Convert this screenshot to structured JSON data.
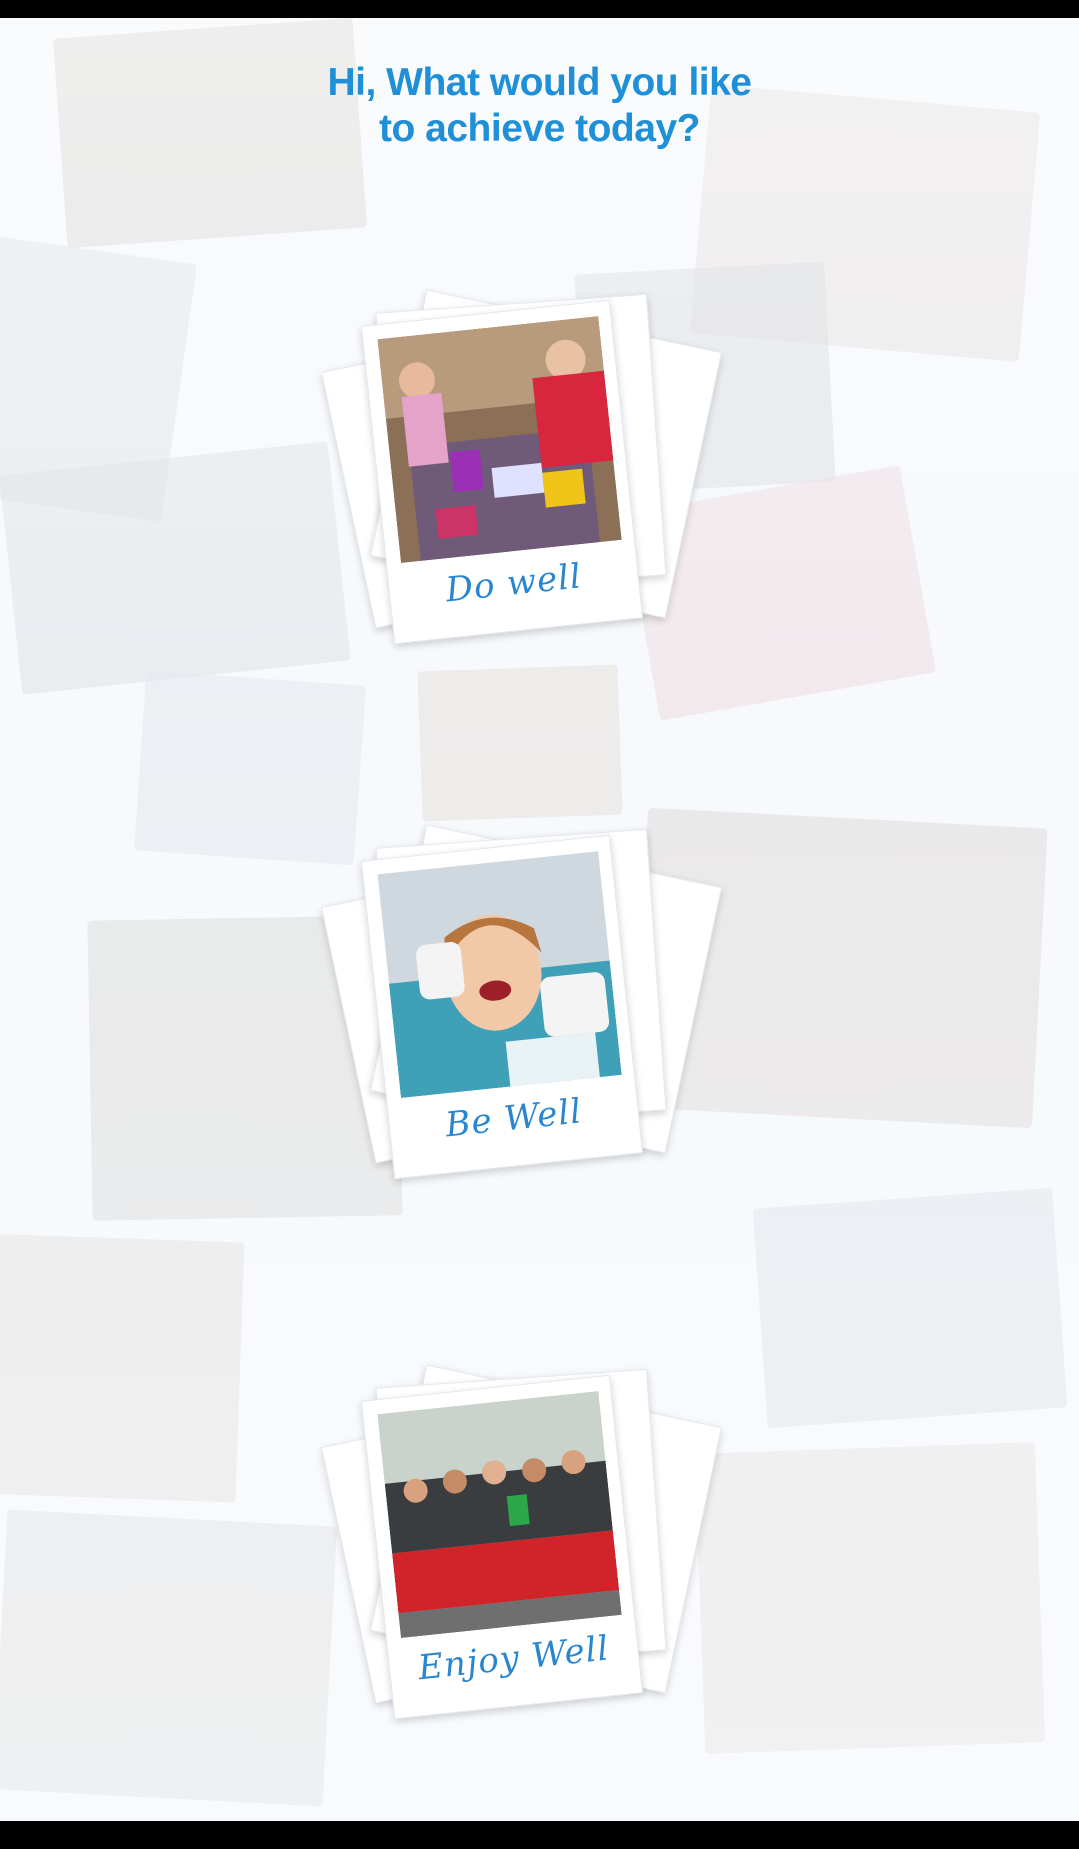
{
  "screen": {
    "heading_line1": "Hi, What would you like",
    "heading_line2": "to achieve today?"
  },
  "cards": [
    {
      "label": "Do well"
    },
    {
      "label": "Be Well"
    },
    {
      "label": "Enjoy Well"
    }
  ],
  "colors": {
    "accent": "#1f8fd8",
    "background": "#f2f6fb"
  }
}
